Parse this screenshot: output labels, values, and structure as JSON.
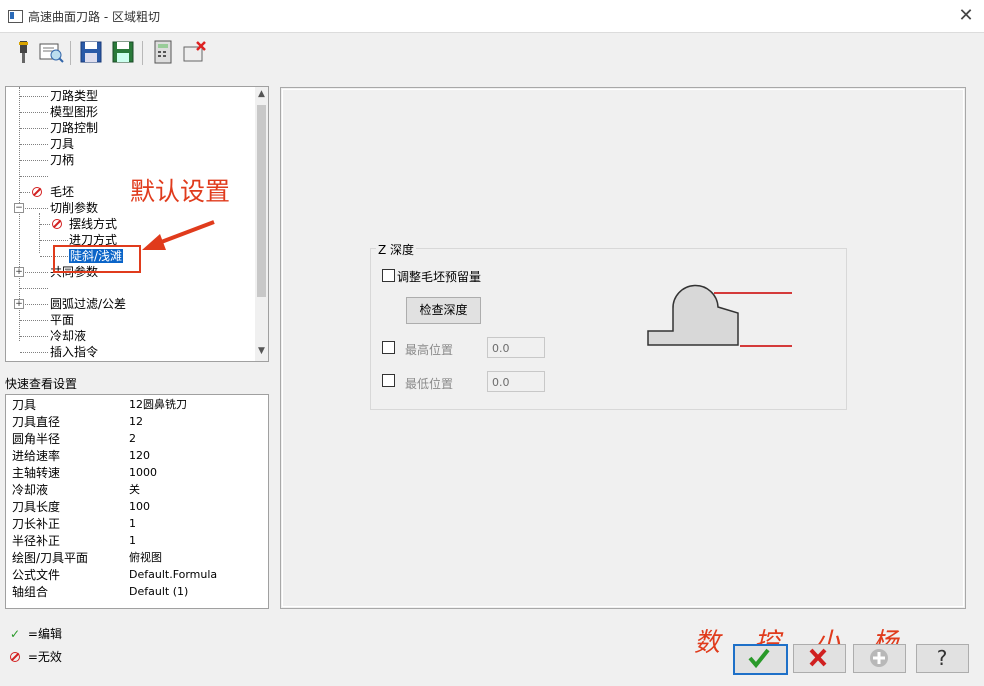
{
  "window": {
    "title": "高速曲面刀路 - 区域粗切"
  },
  "toolbar": {
    "icons": [
      "tool-icon",
      "preview-icon",
      "save-icon",
      "save-as-icon",
      "calculator-icon",
      "delete-icon"
    ]
  },
  "tree": {
    "items": [
      {
        "label": "刀路类型"
      },
      {
        "label": "模型图形"
      },
      {
        "label": "刀路控制"
      },
      {
        "label": "刀具"
      },
      {
        "label": "刀柄"
      },
      {
        "label": "毛坯"
      },
      {
        "label": "切削参数"
      },
      {
        "label": "摆线方式"
      },
      {
        "label": "进刀方式"
      },
      {
        "label": "陡斜/浅滩"
      },
      {
        "label": "共同参数"
      },
      {
        "label": "圆弧过滤/公差"
      },
      {
        "label": "平面"
      },
      {
        "label": "冷却液"
      },
      {
        "label": "插入指令"
      }
    ]
  },
  "annotation": {
    "text": "默认设置"
  },
  "quick_view": {
    "label": "快速查看设置",
    "rows": [
      {
        "name": "刀具",
        "value": "12圆鼻铣刀"
      },
      {
        "name": "刀具直径",
        "value": "12"
      },
      {
        "name": "圆角半径",
        "value": "2"
      },
      {
        "name": "进给速率",
        "value": "120"
      },
      {
        "name": "主轴转速",
        "value": "1000"
      },
      {
        "name": "冷却液",
        "value": "关"
      },
      {
        "name": "刀具长度",
        "value": "100"
      },
      {
        "name": "刀长补正",
        "value": "1"
      },
      {
        "name": "半径补正",
        "value": "1"
      },
      {
        "name": "绘图/刀具平面",
        "value": "俯视图"
      },
      {
        "name": "公式文件",
        "value": "Default.Formula"
      },
      {
        "name": "轴组合",
        "value": "Default (1)"
      }
    ]
  },
  "legend": {
    "edit": "=编辑",
    "invalid": "=无效"
  },
  "z_depth": {
    "title": "Z 深度",
    "adjust_stock_label": "调整毛坯预留量",
    "check_depth_label": "检查深度",
    "max_label": "最高位置",
    "max_value": "0.0",
    "min_label": "最低位置",
    "min_value": "0.0"
  },
  "watermark": [
    "数",
    "控",
    "小",
    "杨"
  ],
  "colors": {
    "annotation": "#e03b1c",
    "selection": "#0a64c8"
  }
}
